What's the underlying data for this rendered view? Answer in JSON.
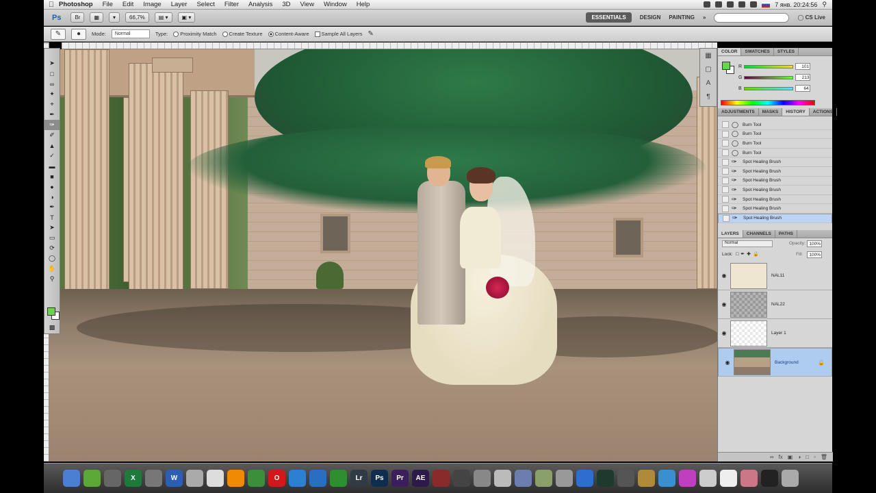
{
  "menubar": {
    "app_name": "Photoshop",
    "items": [
      "File",
      "Edit",
      "Image",
      "Layer",
      "Select",
      "Filter",
      "Analysis",
      "3D",
      "View",
      "Window",
      "Help"
    ],
    "clock": "7 янв. 20:24:56"
  },
  "appbar": {
    "logo": "Ps",
    "zoom": "66,7%",
    "workspaces": [
      "ESSENTIALS",
      "DESIGN",
      "PAINTING",
      "»"
    ],
    "cs_live": "CS Live"
  },
  "options": {
    "mode_label": "Mode:",
    "mode_value": "Normal",
    "type_label": "Type:",
    "type_options": [
      "Proximity Match",
      "Create Texture",
      "Content-Aware"
    ],
    "sample_all": "Sample All Layers"
  },
  "color_panel": {
    "tabs": [
      "COLOR",
      "SWATCHES",
      "STYLES"
    ],
    "channels": [
      {
        "label": "R",
        "value": "101"
      },
      {
        "label": "G",
        "value": "213"
      },
      {
        "label": "B",
        "value": "64"
      }
    ],
    "fg_color": "#66d64a"
  },
  "history_panel": {
    "tabs": [
      "ADJUSTMENTS",
      "MASKS",
      "HISTORY",
      "ACTIONS"
    ],
    "rows": [
      {
        "label": "Burn Tool",
        "icon": "burn-icon"
      },
      {
        "label": "Burn Tool",
        "icon": "burn-icon"
      },
      {
        "label": "Burn Tool",
        "icon": "burn-icon"
      },
      {
        "label": "Burn Tool",
        "icon": "burn-icon"
      },
      {
        "label": "Spot Healing Brush",
        "icon": "healing-brush-icon"
      },
      {
        "label": "Spot Healing Brush",
        "icon": "healing-brush-icon"
      },
      {
        "label": "Spot Healing Brush",
        "icon": "healing-brush-icon"
      },
      {
        "label": "Spot Healing Brush",
        "icon": "healing-brush-icon"
      },
      {
        "label": "Spot Healing Brush",
        "icon": "healing-brush-icon"
      },
      {
        "label": "Spot Healing Brush",
        "icon": "healing-brush-icon"
      },
      {
        "label": "Spot Healing Brush",
        "icon": "healing-brush-icon"
      }
    ]
  },
  "layers_panel": {
    "tabs": [
      "LAYERS",
      "CHANNELS",
      "PATHS"
    ],
    "blend_mode": "Normal",
    "opacity_label": "Opacity:",
    "opacity": "100%",
    "fill_label": "Fill:",
    "fill": "100%",
    "lock_label": "Lock:",
    "layers": [
      {
        "name": "NAL11",
        "thumb": "cream"
      },
      {
        "name": "NAL22",
        "thumb": "dark"
      },
      {
        "name": "Layer 1",
        "thumb": "transparent"
      },
      {
        "name": "Background",
        "thumb": "photo",
        "selected": true
      }
    ]
  },
  "dock": {
    "apps": [
      {
        "label": "",
        "color": "#4a7fd1",
        "icon": "finder-icon"
      },
      {
        "label": "",
        "color": "#5aa835",
        "icon": "messages-icon"
      },
      {
        "label": "",
        "color": "#666",
        "icon": "display-icon"
      },
      {
        "label": "X",
        "color": "#1d7a3a",
        "icon": "excel-icon"
      },
      {
        "label": "",
        "color": "#777",
        "icon": "dashboard-icon"
      },
      {
        "label": "W",
        "color": "#2b5fb3",
        "icon": "word-icon"
      },
      {
        "label": "",
        "color": "#aaa",
        "icon": "textedit-icon"
      },
      {
        "label": "",
        "color": "#ddd",
        "icon": "preview-icon"
      },
      {
        "label": "",
        "color": "#f08a00",
        "icon": "vlc-icon"
      },
      {
        "label": "",
        "color": "#3b8f3b",
        "icon": "android-icon"
      },
      {
        "label": "O",
        "color": "#d21919",
        "icon": "opera-icon"
      },
      {
        "label": "",
        "color": "#2d7fd4",
        "icon": "safari-icon"
      },
      {
        "label": "",
        "color": "#2a6ec2",
        "icon": "itunes-icon"
      },
      {
        "label": "",
        "color": "#2d8f2d",
        "icon": "utorrent-icon"
      },
      {
        "label": "Lr",
        "color": "#2f3b45",
        "icon": "lightroom-icon"
      },
      {
        "label": "Ps",
        "color": "#0f2e4f",
        "icon": "photoshop-icon"
      },
      {
        "label": "Pr",
        "color": "#3a1f5c",
        "icon": "premiere-icon"
      },
      {
        "label": "AE",
        "color": "#2c1a4a",
        "icon": "aftereffects-icon"
      },
      {
        "label": "",
        "color": "#8a2b2b",
        "icon": "flash-icon"
      },
      {
        "label": "",
        "color": "#444",
        "icon": "dvd-icon"
      },
      {
        "label": "",
        "color": "#888",
        "icon": "disk-utility-icon"
      },
      {
        "label": "",
        "color": "#bbb",
        "icon": "mail-icon"
      },
      {
        "label": "",
        "color": "#6a7fb0",
        "icon": "tools-icon"
      },
      {
        "label": "",
        "color": "#8aa06a",
        "icon": "network-icon"
      },
      {
        "label": "",
        "color": "#999",
        "icon": "utilities-icon"
      },
      {
        "label": "",
        "color": "#2c6fce",
        "icon": "appstore-icon"
      },
      {
        "label": "",
        "color": "#1c3a2e",
        "icon": "activity-monitor-icon"
      },
      {
        "label": "",
        "color": "#555",
        "icon": "quicktime-icon"
      },
      {
        "label": "",
        "color": "#b08a3a",
        "icon": "books-icon"
      },
      {
        "label": "",
        "color": "#3a8fd1",
        "icon": "browser-icon"
      },
      {
        "label": "",
        "color": "#c03fc0",
        "icon": "screen-icon"
      },
      {
        "label": "",
        "color": "#ccc",
        "icon": "text-icon"
      },
      {
        "label": "",
        "color": "#eee",
        "icon": "cursor-icon"
      },
      {
        "label": "",
        "color": "#c78",
        "icon": "user-icon"
      },
      {
        "label": "",
        "color": "#222",
        "icon": "terminal-icon"
      },
      {
        "label": "",
        "color": "#aaa",
        "icon": "trash-icon"
      }
    ]
  }
}
